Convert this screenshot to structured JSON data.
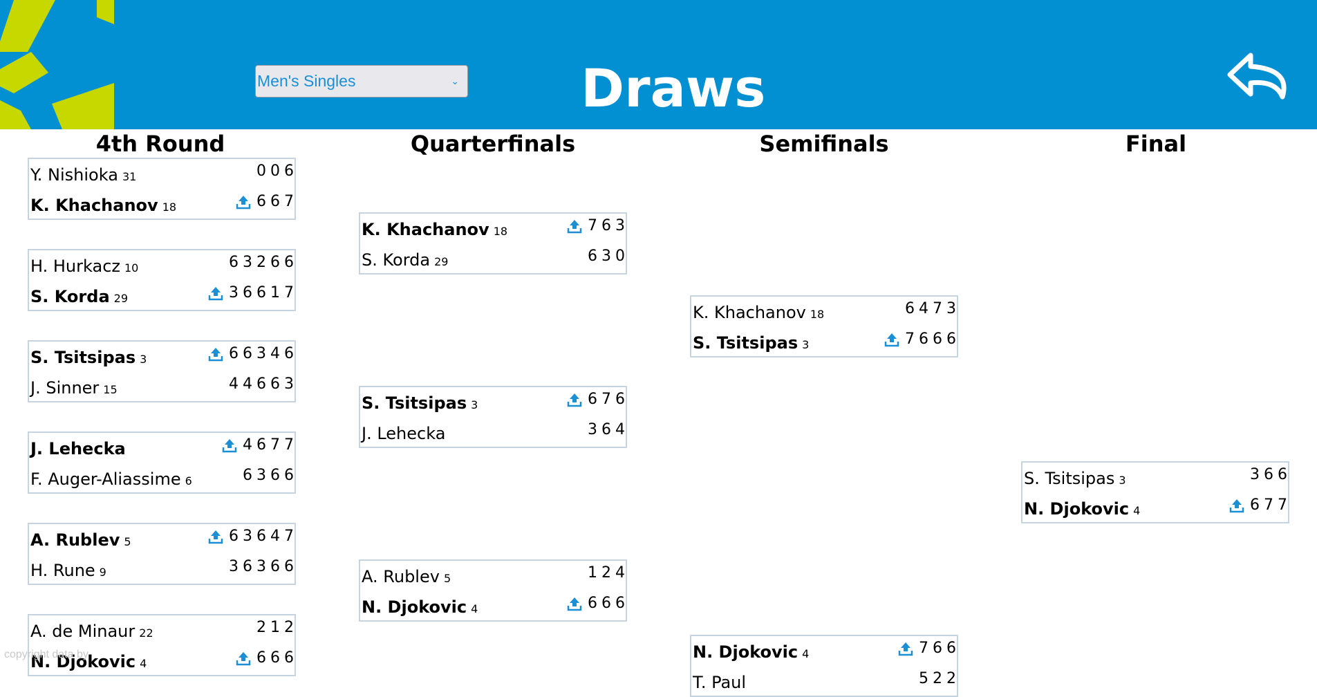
{
  "header": {
    "title": "Draws",
    "draw_select": {
      "value": "Men's Singles"
    },
    "colors": {
      "brand_blue": "#0290d2",
      "accent_lime": "#c6d800"
    },
    "icons": {
      "logo": "tournament-logo",
      "back": "return-arrow-icon",
      "winner": "winner-upload-icon"
    }
  },
  "rounds": [
    {
      "label": "4th Round",
      "matches": [
        {
          "players": [
            {
              "name": "Y. Nishioka",
              "seed": "31",
              "scores": [
                "0",
                "0",
                "6"
              ],
              "winner": false
            },
            {
              "name": "K. Khachanov",
              "seed": "18",
              "scores": [
                "6",
                "6",
                "7"
              ],
              "winner": true
            }
          ]
        },
        {
          "players": [
            {
              "name": "H. Hurkacz",
              "seed": "10",
              "scores": [
                "6",
                "3",
                "2",
                "6",
                "6"
              ],
              "winner": false
            },
            {
              "name": "S. Korda",
              "seed": "29",
              "scores": [
                "3",
                "6",
                "6",
                "1",
                "7"
              ],
              "winner": true
            }
          ]
        },
        {
          "players": [
            {
              "name": "S. Tsitsipas",
              "seed": "3",
              "scores": [
                "6",
                "6",
                "3",
                "4",
                "6"
              ],
              "winner": true
            },
            {
              "name": "J. Sinner",
              "seed": "15",
              "scores": [
                "4",
                "4",
                "6",
                "6",
                "3"
              ],
              "winner": false
            }
          ]
        },
        {
          "players": [
            {
              "name": "J. Lehecka",
              "seed": "",
              "scores": [
                "4",
                "6",
                "7",
                "7"
              ],
              "winner": true
            },
            {
              "name": "F. Auger-Aliassime",
              "seed": "6",
              "scores": [
                "6",
                "3",
                "6",
                "6"
              ],
              "winner": false
            }
          ]
        },
        {
          "players": [
            {
              "name": "A. Rublev",
              "seed": "5",
              "scores": [
                "6",
                "3",
                "6",
                "4",
                "7"
              ],
              "winner": true
            },
            {
              "name": "H. Rune",
              "seed": "9",
              "scores": [
                "3",
                "6",
                "3",
                "6",
                "6"
              ],
              "winner": false
            }
          ]
        },
        {
          "players": [
            {
              "name": "A. de Minaur",
              "seed": "22",
              "scores": [
                "2",
                "1",
                "2"
              ],
              "winner": false
            },
            {
              "name": "N. Djokovic",
              "seed": "4",
              "scores": [
                "6",
                "6",
                "6"
              ],
              "winner": true
            }
          ]
        }
      ]
    },
    {
      "label": "Quarterfinals",
      "matches": [
        {
          "players": [
            {
              "name": "K. Khachanov",
              "seed": "18",
              "scores": [
                "7",
                "6",
                "3"
              ],
              "winner": true
            },
            {
              "name": "S. Korda",
              "seed": "29",
              "scores": [
                "6",
                "3",
                "0"
              ],
              "winner": false
            }
          ]
        },
        {
          "players": [
            {
              "name": "S. Tsitsipas",
              "seed": "3",
              "scores": [
                "6",
                "7",
                "6"
              ],
              "winner": true
            },
            {
              "name": "J. Lehecka",
              "seed": "",
              "scores": [
                "3",
                "6",
                "4"
              ],
              "winner": false
            }
          ]
        },
        {
          "players": [
            {
              "name": "A. Rublev",
              "seed": "5",
              "scores": [
                "1",
                "2",
                "4"
              ],
              "winner": false
            },
            {
              "name": "N. Djokovic",
              "seed": "4",
              "scores": [
                "6",
                "6",
                "6"
              ],
              "winner": true
            }
          ]
        }
      ]
    },
    {
      "label": "Semifinals",
      "matches": [
        {
          "players": [
            {
              "name": "K. Khachanov",
              "seed": "18",
              "scores": [
                "6",
                "4",
                "7",
                "3"
              ],
              "winner": false
            },
            {
              "name": "S. Tsitsipas",
              "seed": "3",
              "scores": [
                "7",
                "6",
                "6",
                "6"
              ],
              "winner": true
            }
          ]
        },
        {
          "players": [
            {
              "name": "N. Djokovic",
              "seed": "4",
              "scores": [
                "7",
                "6",
                "6"
              ],
              "winner": true
            },
            {
              "name": "T. Paul",
              "seed": "",
              "scores": [
                "5",
                "2",
                "2"
              ],
              "winner": false
            }
          ]
        }
      ]
    },
    {
      "label": "Final",
      "matches": [
        {
          "players": [
            {
              "name": "S. Tsitsipas",
              "seed": "3",
              "scores": [
                "3",
                "6",
                "6"
              ],
              "winner": false
            },
            {
              "name": "N. Djokovic",
              "seed": "4",
              "scores": [
                "6",
                "7",
                "7"
              ],
              "winner": true
            }
          ]
        }
      ]
    }
  ],
  "footer": {
    "copyright": "copyright data by"
  }
}
